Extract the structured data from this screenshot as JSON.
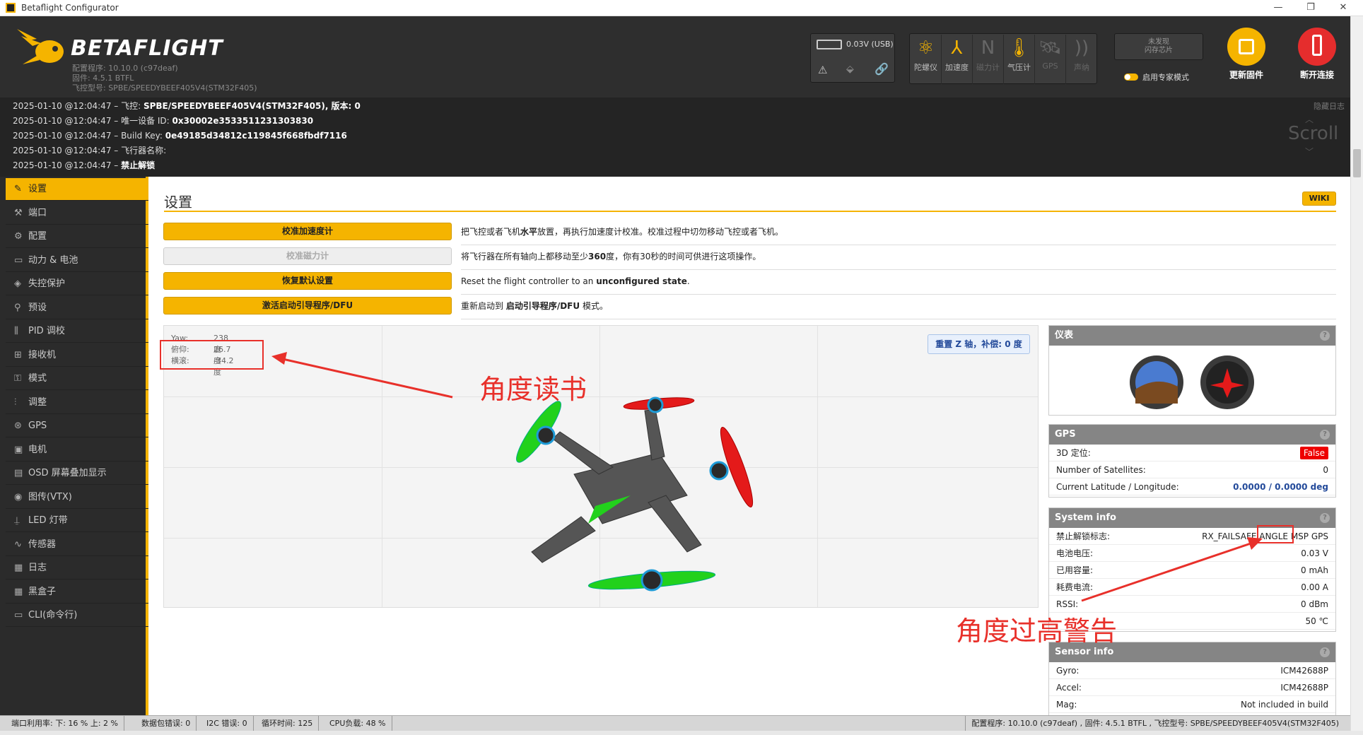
{
  "window": {
    "title": "Betaflight Configurator",
    "min": "—",
    "max": "❐",
    "close": "✕"
  },
  "header": {
    "brand": "BETAFLIGHT",
    "sub_lines": [
      "配置程序: 10.10.0 (c97deaf)",
      "固件: 4.5.1 BTFL",
      "飞控型号: SPBE/SPEEDYBEEF405V4(STM32F405)"
    ],
    "battery_text": "0.03V (USB)",
    "sensors": [
      {
        "label": "陀螺仪",
        "icon": "gyro-icon",
        "glyph": "⚛",
        "active": true
      },
      {
        "label": "加速度",
        "icon": "accel-icon",
        "glyph": "⅄",
        "active": true
      },
      {
        "label": "磁力计",
        "icon": "compass-icon",
        "glyph": "N",
        "active": false
      },
      {
        "label": "气压计",
        "icon": "baro-icon",
        "glyph": "🌡",
        "active": true
      },
      {
        "label": "GPS",
        "icon": "gps-icon",
        "glyph": "🛰",
        "active": false
      },
      {
        "label": "声纳",
        "icon": "sonar-icon",
        "glyph": "))",
        "active": false
      }
    ],
    "flash_text": "未发现\n闪存芯片",
    "expert_mode_label": "启用专家模式",
    "update_fw_label": "更新固件",
    "disconnect_label": "断开连接"
  },
  "log": {
    "hide_label": "隐藏日志",
    "scroll_label": "Scroll",
    "lines": [
      {
        "prefix": "2025-01-10 @12:04:47 – 飞控: ",
        "value": "SPBE/SPEEDYBEEF405V4(STM32F405), 版本: 0"
      },
      {
        "prefix": "2025-01-10 @12:04:47 – 唯一设备 ID: ",
        "value": "0x30002e3533511231303830"
      },
      {
        "prefix": "2025-01-10 @12:04:47 – Build Key: ",
        "value": "0e49185d34812c119845f668fbdf7116"
      },
      {
        "prefix": "2025-01-10 @12:04:47 – 飞行器名称:",
        "value": ""
      },
      {
        "prefix": "2025-01-10 @12:04:47 – ",
        "value": "禁止解锁"
      }
    ]
  },
  "sidebar": [
    {
      "label": "设置",
      "icon": "wrench-icon",
      "glyph": "✎",
      "active": true
    },
    {
      "label": "端口",
      "icon": "port-icon",
      "glyph": "⚒"
    },
    {
      "label": "配置",
      "icon": "gear-icon",
      "glyph": "⚙"
    },
    {
      "label": "动力 & 电池",
      "icon": "battery-icon",
      "glyph": "▭"
    },
    {
      "label": "失控保护",
      "icon": "failsafe-icon",
      "glyph": "◈"
    },
    {
      "label": "预设",
      "icon": "presets-icon",
      "glyph": "⚲"
    },
    {
      "label": "PID 调校",
      "icon": "pid-icon",
      "glyph": "⫼"
    },
    {
      "label": "接收机",
      "icon": "receiver-icon",
      "glyph": "⊞"
    },
    {
      "label": "模式",
      "icon": "modes-icon",
      "glyph": "⚿"
    },
    {
      "label": "调整",
      "icon": "adjust-icon",
      "glyph": "⫶"
    },
    {
      "label": "GPS",
      "icon": "gps-icon",
      "glyph": "⊛"
    },
    {
      "label": "电机",
      "icon": "motor-icon",
      "glyph": "▣"
    },
    {
      "label": "OSD 屏幕叠加显示",
      "icon": "osd-icon",
      "glyph": "▤"
    },
    {
      "label": "图传(VTX)",
      "icon": "vtx-icon",
      "glyph": "◉"
    },
    {
      "label": "LED 灯带",
      "icon": "led-icon",
      "glyph": "⍊"
    },
    {
      "label": "传感器",
      "icon": "sensors-icon",
      "glyph": "∿"
    },
    {
      "label": "日志",
      "icon": "log-icon",
      "glyph": "▦"
    },
    {
      "label": "黑盒子",
      "icon": "blackbox-icon",
      "glyph": "▦"
    },
    {
      "label": "CLI(命令行)",
      "icon": "cli-icon",
      "glyph": "▭"
    }
  ],
  "setup": {
    "title": "设置",
    "wiki": "WIKI",
    "actions": [
      {
        "label": "校准加速度计",
        "disabled": false,
        "desc_parts": [
          "把飞控或者飞机",
          "水平",
          "放置，再执行加速度计校准。校准过程中切勿移动飞控或者飞机。"
        ]
      },
      {
        "label": "校准磁力计",
        "disabled": true,
        "desc_parts": [
          "将飞行器在所有轴向上都移动至少",
          "360",
          "度，你有30秒的时间可供进行这项操作。"
        ]
      },
      {
        "label": "恢复默认设置",
        "disabled": false,
        "desc_parts": [
          "Reset the flight controller to an ",
          "unconfigured state",
          "."
        ]
      },
      {
        "label": "激活启动引导程序/DFU",
        "disabled": false,
        "desc_parts": [
          "重新启动到 ",
          "启动引导程序/DFU",
          " 模式。"
        ]
      }
    ],
    "attitude": {
      "yaw_label": "Yaw:",
      "yaw": "238 度",
      "pitch_label": "俯仰:",
      "pitch": "26.7 度",
      "roll_label": "横滚:",
      "roll": "-34.2 度"
    },
    "reset_z": "重置 Z 轴，补偿: 0 度"
  },
  "panels": {
    "instruments": {
      "title": "仪表"
    },
    "gps": {
      "title": "GPS",
      "rows": [
        {
          "k": "3D 定位:",
          "v": "False",
          "badge": true
        },
        {
          "k": "Number of Satellites:",
          "v": "0"
        },
        {
          "k": "Current Latitude / Longitude:",
          "v": "0.0000 / 0.0000 deg",
          "link": true
        }
      ]
    },
    "system": {
      "title": "System info",
      "rows": [
        {
          "k": "禁止解锁标志:",
          "v": "RX_FAILSAFE ANGLE MSP GPS"
        },
        {
          "k": "电池电压:",
          "v": "0.03 V"
        },
        {
          "k": "已用容量:",
          "v": "0 mAh"
        },
        {
          "k": "耗费电流:",
          "v": "0.00 A"
        },
        {
          "k": "RSSI:",
          "v": "0 dBm"
        },
        {
          "k": "",
          "v": "50 ℃"
        }
      ]
    },
    "sensor": {
      "title": "Sensor info",
      "rows": [
        {
          "k": "Gyro:",
          "v": "ICM42688P"
        },
        {
          "k": "Accel:",
          "v": "ICM42688P"
        },
        {
          "k": "Mag:",
          "v": "Not included in build"
        }
      ]
    }
  },
  "annotations": {
    "angle_reading": "角度读书",
    "angle_warning": "角度过高警告"
  },
  "status": {
    "port_util": "端口利用率:  下: 16 %  上: 2 %",
    "packet_err": "数据包错误: 0",
    "i2c_err": "I2C 错误: 0",
    "cycle": "循环时间: 125",
    "cpu": "CPU负载: 48 %",
    "right": "配置程序: 10.10.0 (c97deaf) , 固件: 4.5.1 BTFL , 飞控型号: SPBE/SPEEDYBEEF405V4(STM32F405)"
  },
  "colors": {
    "accent": "#f5b400",
    "annotation": "#e8302a",
    "header_bg": "#2e2e2e"
  }
}
